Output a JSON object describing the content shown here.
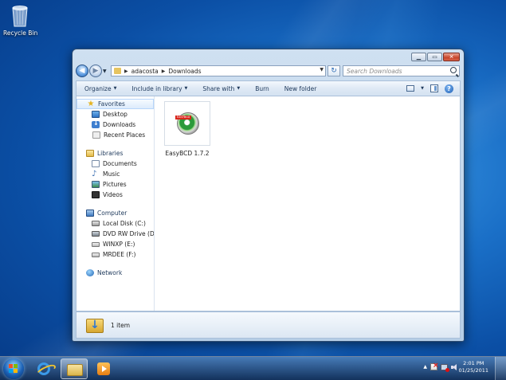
{
  "desktop": {
    "recycle_bin_label": "Recycle Bin"
  },
  "window": {
    "address": {
      "crumbs": [
        "adacosta",
        "Downloads"
      ]
    },
    "search": {
      "placeholder": "Search Downloads"
    },
    "toolbar": {
      "organize": "Organize",
      "include_in_library": "Include in library",
      "share_with": "Share with",
      "burn": "Burn",
      "new_folder": "New folder"
    },
    "nav": {
      "favorites": {
        "label": "Favorites",
        "items": [
          "Desktop",
          "Downloads",
          "Recent Places"
        ]
      },
      "libraries": {
        "label": "Libraries",
        "items": [
          "Documents",
          "Music",
          "Pictures",
          "Videos"
        ]
      },
      "computer": {
        "label": "Computer",
        "items": [
          "Local Disk (C:)",
          "DVD RW Drive (D:) G",
          "WINXP (E:)",
          "MRDEE (F:)"
        ]
      },
      "network": {
        "label": "Network"
      }
    },
    "files": [
      {
        "name": "EasyBCD 1.7.2",
        "icon": "easybcd-disc-icon",
        "badge": "EASYBCD"
      }
    ],
    "details": {
      "count": "1 item"
    }
  },
  "taskbar": {
    "clock_time": "2:01 PM",
    "clock_date": "01/25/2011",
    "pinned": [
      "internet-explorer",
      "windows-explorer",
      "windows-media-player"
    ]
  },
  "colors": {
    "accent": "#1e395b",
    "desktop_blue": "#1a6fc7"
  }
}
